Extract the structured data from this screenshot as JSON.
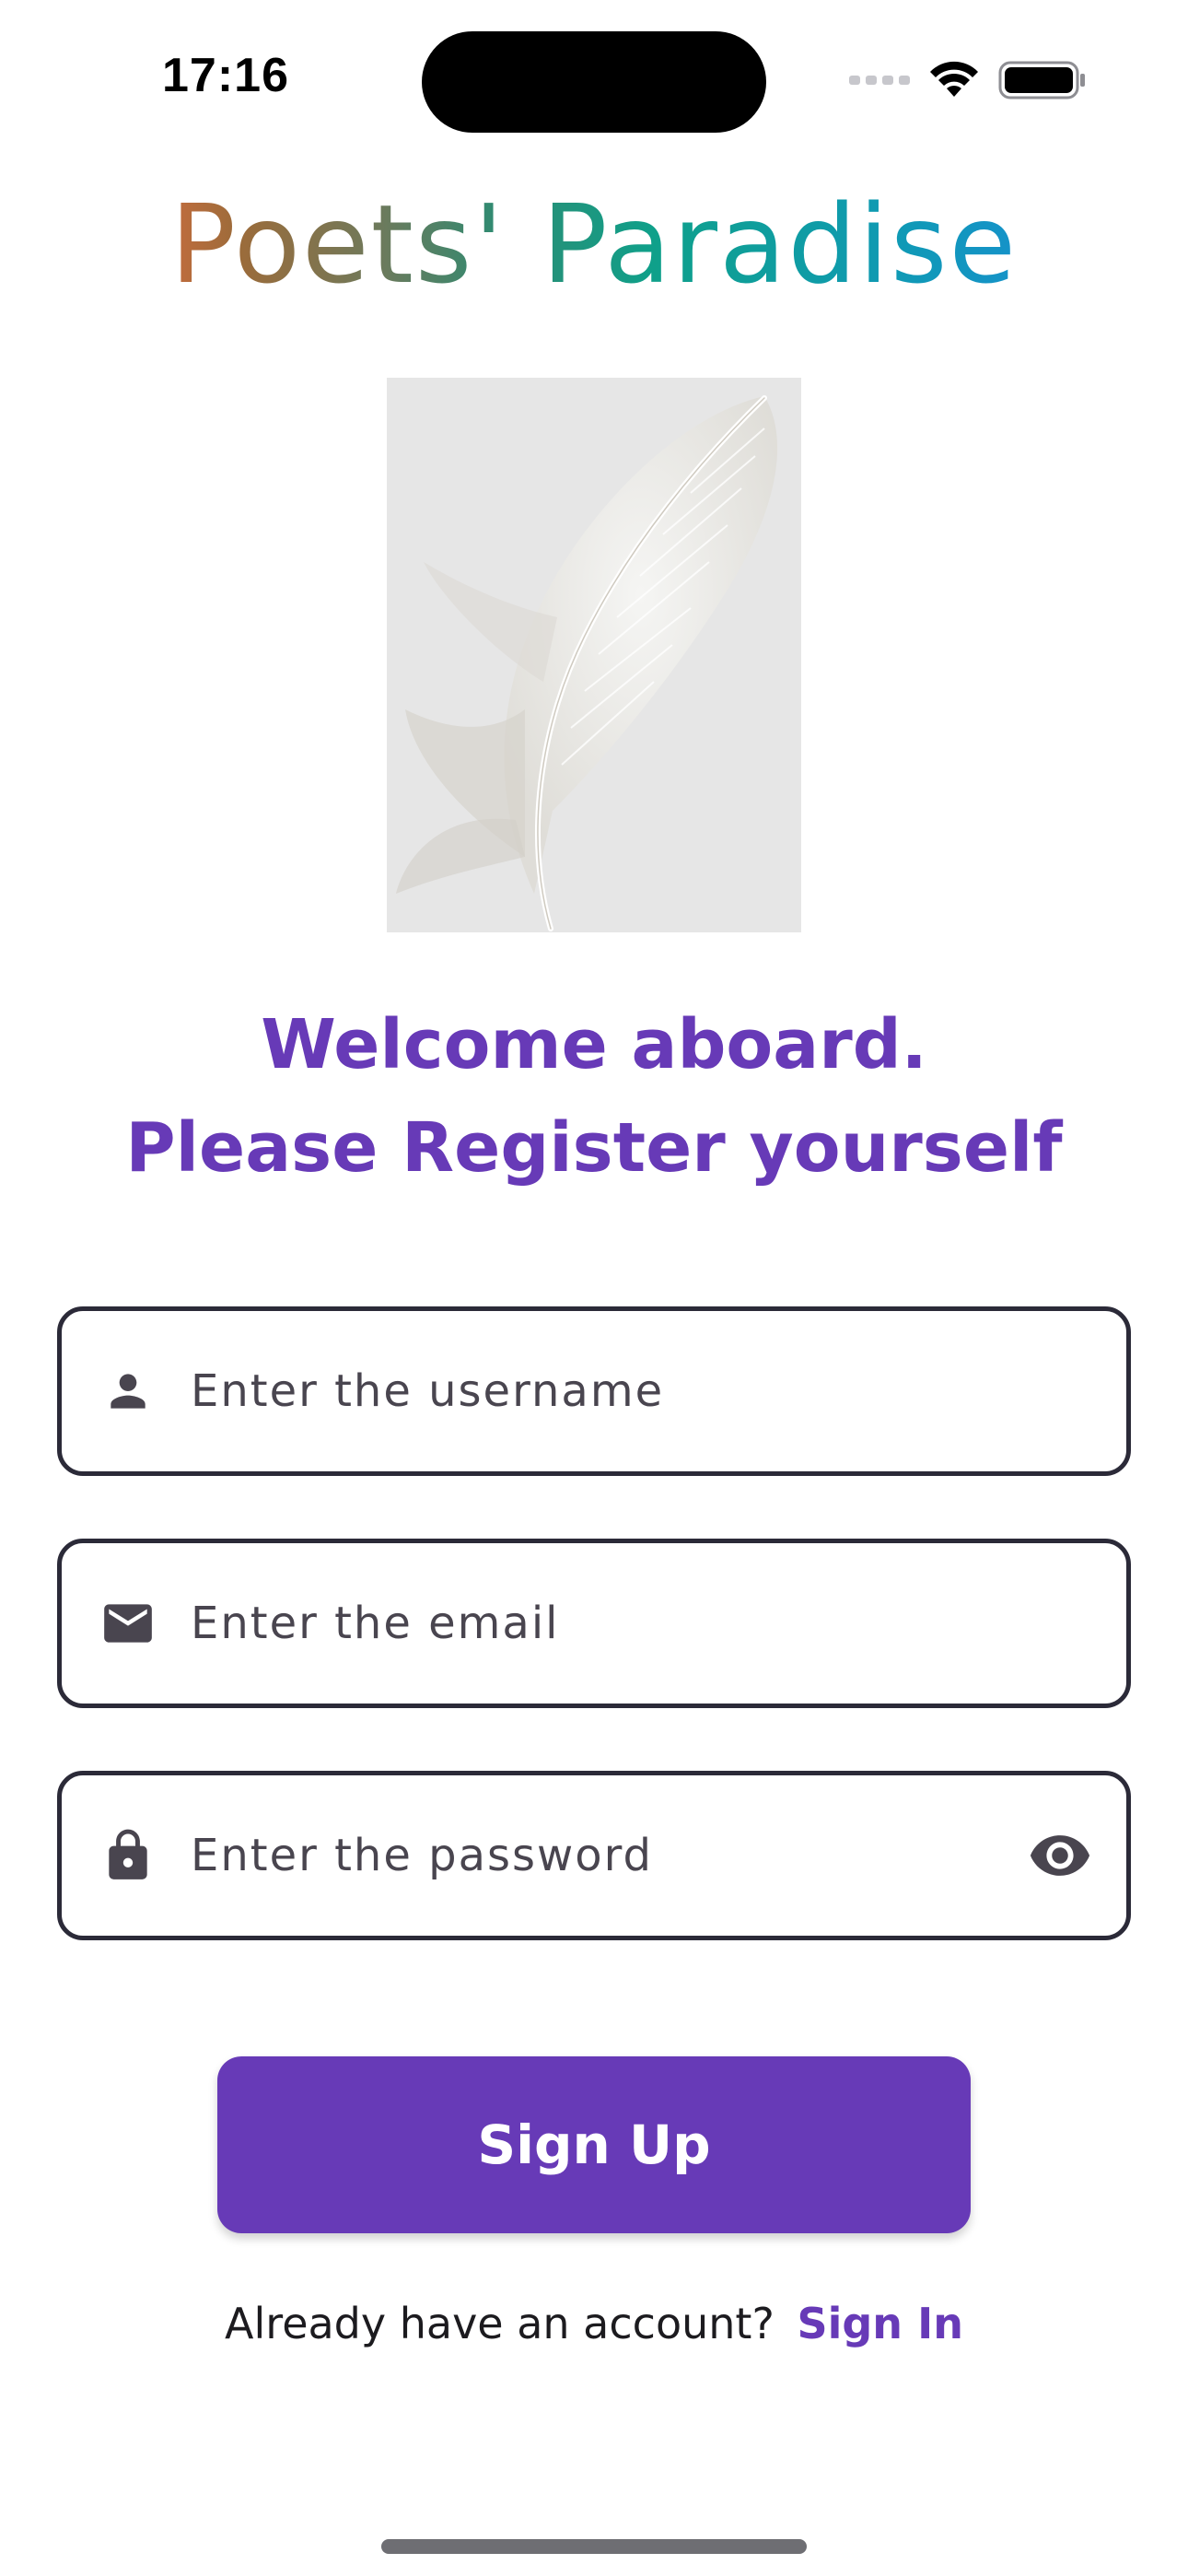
{
  "status_bar": {
    "time": "17:16",
    "wifi_icon": "wifi-icon",
    "battery_icon": "battery-icon",
    "signal_icon": "cellular-signal-icon"
  },
  "app": {
    "title": "Poets' Paradise",
    "illustration_icon": "feather-image"
  },
  "welcome": {
    "line1": "Welcome aboard.",
    "line2": "Please Register yourself"
  },
  "form": {
    "username": {
      "icon": "person-icon",
      "placeholder": "Enter the username",
      "value": ""
    },
    "email": {
      "icon": "mail-icon",
      "placeholder": "Enter the email",
      "value": ""
    },
    "password": {
      "icon": "lock-icon",
      "placeholder": "Enter the password",
      "value": "",
      "toggle_icon": "eye-icon"
    },
    "submit_label": "Sign Up"
  },
  "footer": {
    "prompt": "Already have an account?",
    "link_label": "Sign In"
  },
  "colors": {
    "accent": "#673ab7",
    "field_border": "#2b2a38",
    "icon": "#49454f"
  }
}
